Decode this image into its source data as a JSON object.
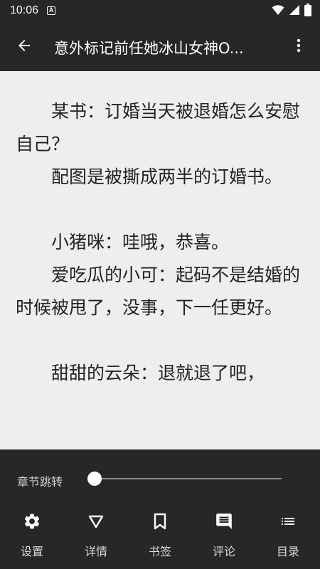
{
  "status_bar": {
    "time": "10:06",
    "notification_badge": "A",
    "icons": [
      "wifi-icon",
      "signal-icon",
      "battery-icon"
    ]
  },
  "app_bar": {
    "title": "意外标记前任她冰山女神O..."
  },
  "content": {
    "paragraphs": [
      "某书：订婚当天被退婚怎么安慰自己？",
      "配图是被撕成两半的订婚书。",
      "小猪咪：哇哦，恭喜。",
      "爱吃瓜的小可：起码不是结婚的时候被甩了，没事，下一任更好。",
      "甜甜的云朵：退就退了吧，"
    ]
  },
  "chapter_jump": {
    "label": "章节跳转",
    "progress": 0
  },
  "nav": {
    "items": [
      {
        "label": "设置",
        "icon": "gear-icon"
      },
      {
        "label": "详情",
        "icon": "triangle-down-icon"
      },
      {
        "label": "书签",
        "icon": "bookmark-icon"
      },
      {
        "label": "评论",
        "icon": "comment-icon"
      },
      {
        "label": "目录",
        "icon": "list-icon"
      }
    ]
  },
  "colors": {
    "bar_background": "#272727",
    "page_background": "#eeeeee",
    "text": "#222222"
  }
}
